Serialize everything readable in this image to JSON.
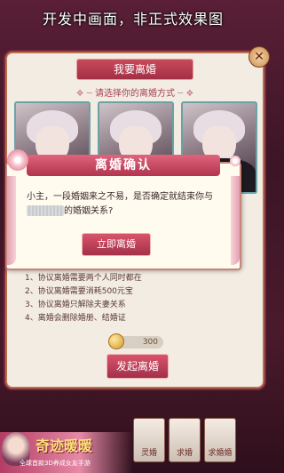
{
  "watermark": "开发中画面，非正式效果图",
  "panel": {
    "title": "我要离婚",
    "subtitle": "请选择你的离婚方式",
    "rules": [
      "1、协议离婚需要两个人同时都在",
      "2、协议离婚需要消耗500元宝",
      "3、协议离婚只解除夫妻关系",
      "4、离婚会删除婚册、结婚证"
    ],
    "cost": "300",
    "start_button": "发起离婚"
  },
  "dialog": {
    "title": "离婚确认",
    "text_before": "小主，一段婚姻来之不易，是否确定就结束你与",
    "text_after": "的婚姻关系?",
    "confirm_button": "立即离婚"
  },
  "bottom_tabs": [
    "灵婚",
    "求婚",
    "求婚婚"
  ],
  "ad": {
    "logo": "奇迹暖暖",
    "caption": "全球首款3D养成女友手游"
  },
  "colors": {
    "accent": "#b2344f",
    "panel_bg": "#f3ece2",
    "border": "#b8704f"
  }
}
